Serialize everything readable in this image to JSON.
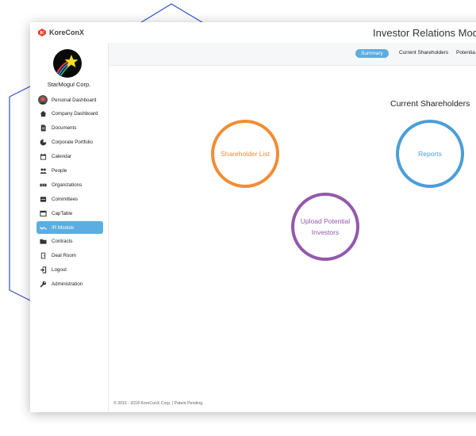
{
  "app": {
    "brand": "KoreConX",
    "title": "Investor Relations Module"
  },
  "sidebar": {
    "company": "StarMogul Corp.",
    "items": [
      {
        "label": "Personal Dashboard",
        "icon": "user-avatar-icon"
      },
      {
        "label": "Company Dashboard",
        "icon": "home-icon"
      },
      {
        "label": "Documents",
        "icon": "document-icon"
      },
      {
        "label": "Corporate Portfolio",
        "icon": "portfolio-icon"
      },
      {
        "label": "Calendar",
        "icon": "calendar-icon"
      },
      {
        "label": "People",
        "icon": "people-icon"
      },
      {
        "label": "Organizations",
        "icon": "organizations-icon"
      },
      {
        "label": "Committees",
        "icon": "committees-icon"
      },
      {
        "label": "CapTable",
        "icon": "captable-icon"
      },
      {
        "label": "IR Module",
        "icon": "chart-icon",
        "active": true
      },
      {
        "label": "Contracts",
        "icon": "folder-icon"
      },
      {
        "label": "Deal Room",
        "icon": "door-icon"
      },
      {
        "label": "Logout",
        "icon": "logout-icon"
      },
      {
        "label": "Administration",
        "icon": "wrench-icon"
      }
    ]
  },
  "tabs": [
    {
      "label": "Summary",
      "active": true
    },
    {
      "label": "Current Shareholders"
    },
    {
      "label": "Potentia"
    }
  ],
  "main": {
    "section_title": "Current Shareholders",
    "tiles": {
      "shareholder_list": "Shareholder List",
      "reports": "Reports",
      "upload_line1": "Upload Potential",
      "upload_line2": "Investors"
    }
  },
  "footer": "© 2015 - 2018 KoreConX Corp. | Patent Pending.",
  "colors": {
    "accent": "#5aaee0",
    "orange": "#f28c34",
    "blue": "#4a9ed8",
    "purple": "#9359ad",
    "brand_red": "#e8452c",
    "hex_outline": "#3355cc"
  }
}
